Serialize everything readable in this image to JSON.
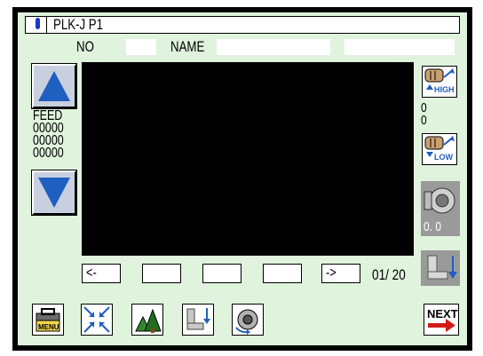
{
  "title": "PLK-J  P1",
  "header": {
    "no_label": "NO",
    "name_label": "NAME"
  },
  "feed": {
    "label": "FEED",
    "values": [
      "00000",
      "00000",
      "00000"
    ]
  },
  "nav": {
    "prev_label": "<-",
    "next_label": "->",
    "page": "01/ 20"
  },
  "speed": {
    "high_label": "HIGH",
    "low_label": "LOW",
    "value_1": "0",
    "value_2": "0"
  },
  "tension": {
    "value": "0. 0"
  },
  "toolbar": {
    "menu_label": "MENU",
    "next_label": "NEXT"
  },
  "colors": {
    "panel": "#dff3dd",
    "arrow_blue": "#1f5fbf",
    "title_marker": "#1a37c8",
    "next_arrow": "#d11a1a"
  }
}
